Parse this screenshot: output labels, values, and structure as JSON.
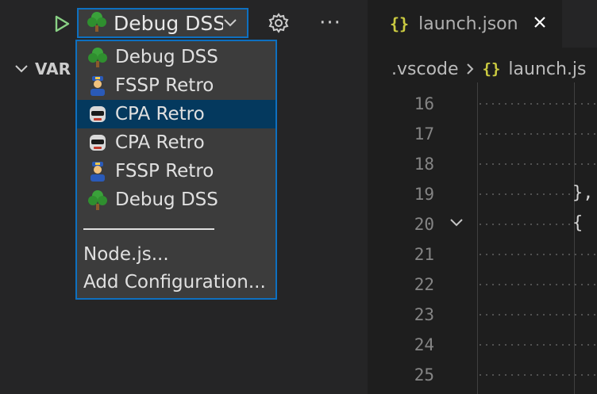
{
  "toolbar": {
    "run_icon": "play-icon",
    "selected_config": "Debug DSS",
    "gear_icon": "gear-icon",
    "more_label": "···"
  },
  "sidebar": {
    "section_label": "VAR"
  },
  "dropdown": {
    "items": [
      {
        "label": "Debug DSS",
        "icon": "tree-emoji"
      },
      {
        "label": "FSSP Retro",
        "icon": "police-officer-emoji"
      },
      {
        "label": "CPA Retro",
        "icon": "robot-emoji",
        "selected": true
      },
      {
        "label": "CPA Retro",
        "icon": "robot-emoji"
      },
      {
        "label": "FSSP Retro",
        "icon": "police-officer-emoji"
      },
      {
        "label": "Debug DSS",
        "icon": "tree-emoji"
      }
    ],
    "actions": [
      "Node.js...",
      "Add Configuration..."
    ]
  },
  "editor": {
    "tab": {
      "braces": "{}",
      "filename": "launch.json"
    },
    "breadcrumb": {
      "folder": ".vscode",
      "braces": "{}",
      "file": "launch.js"
    },
    "lines": [
      {
        "num": "16",
        "code": ""
      },
      {
        "num": "17",
        "code": ""
      },
      {
        "num": "18",
        "code": ""
      },
      {
        "num": "19",
        "code": "},"
      },
      {
        "num": "20",
        "code": "{"
      },
      {
        "num": "21",
        "code": ""
      },
      {
        "num": "22",
        "code": ""
      },
      {
        "num": "23",
        "code": ""
      },
      {
        "num": "24",
        "code": ""
      },
      {
        "num": "25",
        "code": ""
      }
    ]
  },
  "colors": {
    "accent": "#0e70c0",
    "selected_bg": "#04395e",
    "run_green": "#89d185",
    "json_yellow": "#cbcb41"
  }
}
